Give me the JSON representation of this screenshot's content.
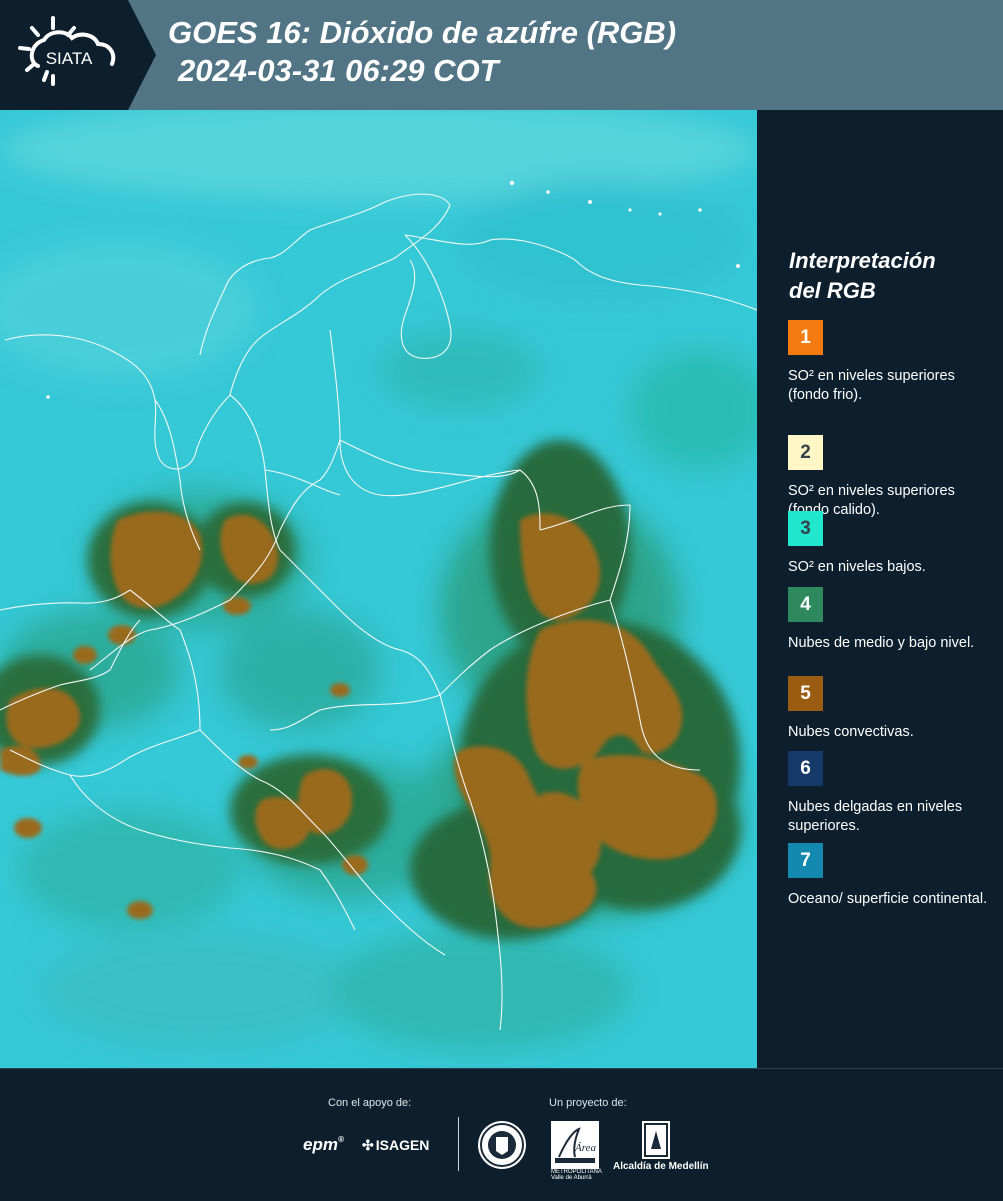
{
  "header": {
    "logo_text": "SIATA",
    "title_line1": "GOES 16: Dióxido de azúfre (RGB)",
    "title_line2": "2024-03-31 06:29 COT"
  },
  "legend": {
    "title_line1": "Interpretación",
    "title_line2": "del RGB",
    "items": [
      {
        "num": "1",
        "color": "#f47b10",
        "num_color": "#ffffff",
        "text": "SO² en niveles superiores (fondo frio)."
      },
      {
        "num": "2",
        "color": "#fff6c5",
        "num_color": "#35414a",
        "text": "SO² en niveles superiores (fondo calido)."
      },
      {
        "num": "3",
        "color": "#1fe8cf",
        "num_color": "#35414a",
        "text": "SO² en niveles bajos."
      },
      {
        "num": "4",
        "color": "#2e8a5e",
        "num_color": "#ffffff",
        "text": "Nubes de medio y bajo nivel."
      },
      {
        "num": "5",
        "color": "#9a5c10",
        "num_color": "#ffffff",
        "text": "Nubes convectivas."
      },
      {
        "num": "6",
        "color": "#153a6a",
        "num_color": "#ffffff",
        "text": "Nubes delgadas en niveles superiores."
      },
      {
        "num": "7",
        "color": "#1489b0",
        "num_color": "#ffffff",
        "text": "Oceano/ superficie continental."
      }
    ]
  },
  "footer": {
    "support_label": "Con el apoyo de:",
    "project_label": "Un proyecto de:",
    "sponsor_1": "epm",
    "sponsor_2": "ISAGEN",
    "partner_1": "Universidad de Medellín",
    "partner_2_line1": "METROPOLITANA",
    "partner_2_line2": "Valle de Aburrá",
    "partner_3": "Alcaldía de Medellín"
  },
  "colors": {
    "background": "#0d1f2c",
    "header_band": "#527585",
    "ocean": "#35c8d6",
    "convective": "#9a6b1e",
    "mid_low_cloud": "#2e8a5e"
  }
}
